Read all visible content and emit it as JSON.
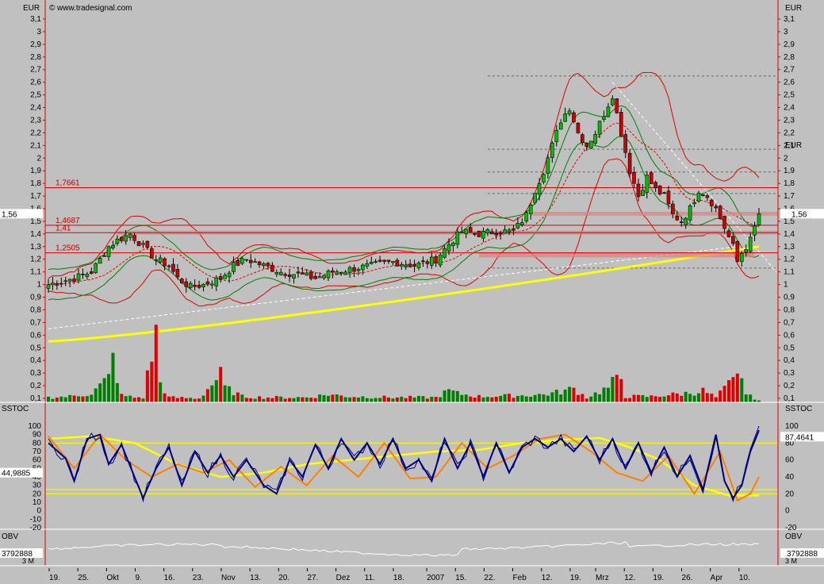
{
  "header": {
    "source": "www.tradesignal.com"
  },
  "chart_data": [
    {
      "type": "candlestick",
      "title": "",
      "unit": "EUR",
      "ylim": [
        0,
        3.15
      ],
      "y_ticks": [
        "3,1",
        "3",
        "2,9",
        "2,8",
        "2,7",
        "2,6",
        "2,5",
        "2,4",
        "2,3",
        "2,2",
        "2,1",
        "2",
        "1,9",
        "1,8",
        "1,7",
        "1,6",
        "1,5",
        "1,4",
        "1,3",
        "1,2",
        "1,1",
        "1",
        "0,9",
        "0,8",
        "0,7",
        "0,6",
        "0,5",
        "0,4",
        "0,3",
        "0,2",
        "0,1"
      ],
      "last_price_label": "1,56",
      "last_price": 1.56,
      "horizontal_levels": [
        {
          "label": "1,7661",
          "value": 1.7661
        },
        {
          "label": "1,4687",
          "value": 1.4687
        },
        {
          "label": "1,41",
          "value": 1.41
        },
        {
          "label": "1,2505",
          "value": 1.2505
        }
      ],
      "x_tick_labels": [
        "19.",
        "25.",
        "Okt",
        "9.",
        "16.",
        "23.",
        "Nov",
        "13.",
        "20.",
        "27.",
        "Dez",
        "11.",
        "18.",
        "2007",
        "15.",
        "22.",
        "Feb",
        "12.",
        "19.",
        "Mrz",
        "12.",
        "19.",
        "26.",
        "Apr",
        "10."
      ],
      "close_path": [
        [
          0,
          1.0
        ],
        [
          6,
          1.05
        ],
        [
          10,
          1.1
        ],
        [
          14,
          1.3
        ],
        [
          16,
          1.35
        ],
        [
          19,
          1.4
        ],
        [
          22,
          1.3
        ],
        [
          25,
          1.2
        ],
        [
          28,
          1.15
        ],
        [
          30,
          1.05
        ],
        [
          33,
          0.98
        ],
        [
          36,
          1.0
        ],
        [
          40,
          1.05
        ],
        [
          43,
          1.15
        ],
        [
          46,
          1.2
        ],
        [
          50,
          1.15
        ],
        [
          54,
          1.1
        ],
        [
          58,
          1.08
        ],
        [
          62,
          1.05
        ],
        [
          66,
          1.1
        ],
        [
          70,
          1.12
        ],
        [
          75,
          1.15
        ],
        [
          80,
          1.18
        ],
        [
          85,
          1.15
        ],
        [
          90,
          1.2
        ],
        [
          93,
          1.32
        ],
        [
          96,
          1.42
        ],
        [
          100,
          1.4
        ],
        [
          104,
          1.42
        ],
        [
          108,
          1.42
        ],
        [
          111,
          1.55
        ],
        [
          113,
          1.75
        ],
        [
          115,
          1.9
        ],
        [
          117,
          2.1
        ],
        [
          119,
          2.3
        ],
        [
          121,
          2.4
        ],
        [
          123,
          2.2
        ],
        [
          125,
          2.1
        ],
        [
          127,
          2.2
        ],
        [
          129,
          2.35
        ],
        [
          131,
          2.5
        ],
        [
          133,
          2.2
        ],
        [
          135,
          1.9
        ],
        [
          137,
          1.7
        ],
        [
          139,
          1.85
        ],
        [
          141,
          1.75
        ],
        [
          143,
          1.7
        ],
        [
          145,
          1.55
        ],
        [
          147,
          1.5
        ],
        [
          149,
          1.6
        ],
        [
          151,
          1.75
        ],
        [
          153,
          1.7
        ],
        [
          155,
          1.6
        ],
        [
          157,
          1.45
        ],
        [
          159,
          1.3
        ],
        [
          160,
          1.18
        ],
        [
          161,
          1.25
        ],
        [
          163,
          1.35
        ],
        [
          165,
          1.56
        ]
      ],
      "volume_path": [
        [
          0,
          0.05
        ],
        [
          5,
          0.06
        ],
        [
          10,
          0.09
        ],
        [
          14,
          0.25
        ],
        [
          15,
          0.45
        ],
        [
          17,
          0.07
        ],
        [
          20,
          0.05
        ],
        [
          22,
          0.05
        ],
        [
          25,
          0.7
        ],
        [
          26,
          0.2
        ],
        [
          28,
          0.05
        ],
        [
          35,
          0.04
        ],
        [
          40,
          0.28
        ],
        [
          41,
          0.15
        ],
        [
          45,
          0.06
        ],
        [
          50,
          0.05
        ],
        [
          60,
          0.05
        ],
        [
          65,
          0.08
        ],
        [
          70,
          0.06
        ],
        [
          80,
          0.05
        ],
        [
          90,
          0.05
        ],
        [
          93,
          0.12
        ],
        [
          95,
          0.09
        ],
        [
          100,
          0.06
        ],
        [
          110,
          0.07
        ],
        [
          115,
          0.08
        ],
        [
          118,
          0.1
        ],
        [
          122,
          0.14
        ],
        [
          125,
          0.05
        ],
        [
          130,
          0.15
        ],
        [
          131,
          0.2
        ],
        [
          133,
          0.25
        ],
        [
          134,
          0.06
        ],
        [
          140,
          0.06
        ],
        [
          145,
          0.08
        ],
        [
          150,
          0.1
        ],
        [
          152,
          0.12
        ],
        [
          155,
          0.05
        ],
        [
          158,
          0.18
        ],
        [
          160,
          0.25
        ],
        [
          161,
          0.3
        ],
        [
          162,
          0.08
        ],
        [
          165,
          0.02
        ]
      ],
      "volume_ticks": [
        "0,7",
        "0,6",
        "0,5",
        "0,4",
        "0,3",
        "0,2",
        "0,1"
      ]
    },
    {
      "type": "line",
      "title": "SSTOC",
      "ylim": [
        -20,
        100
      ],
      "y_ticks": [
        "100",
        "90",
        "80",
        "70",
        "60",
        "50",
        "40",
        "30",
        "20",
        "10",
        "0",
        "-10",
        "-20"
      ],
      "y_ticks_right": [
        "100",
        "80",
        "60",
        "40",
        "20",
        "0",
        "-20"
      ],
      "value_label_left": "44,9885",
      "value_label_right": "87,4641",
      "levels": [
        80,
        20,
        25
      ],
      "series_key_points": {
        "fast": [
          [
            0,
            80
          ],
          [
            4,
            62
          ],
          [
            6,
            35
          ],
          [
            9,
            85
          ],
          [
            12,
            90
          ],
          [
            14,
            55
          ],
          [
            17,
            78
          ],
          [
            20,
            40
          ],
          [
            22,
            15
          ],
          [
            25,
            50
          ],
          [
            28,
            75
          ],
          [
            31,
            30
          ],
          [
            34,
            70
          ],
          [
            37,
            45
          ],
          [
            40,
            65
          ],
          [
            43,
            40
          ],
          [
            46,
            60
          ],
          [
            50,
            30
          ],
          [
            53,
            20
          ],
          [
            56,
            60
          ],
          [
            59,
            40
          ],
          [
            62,
            78
          ],
          [
            65,
            50
          ],
          [
            68,
            85
          ],
          [
            71,
            60
          ],
          [
            74,
            80
          ],
          [
            77,
            55
          ],
          [
            80,
            85
          ],
          [
            83,
            50
          ],
          [
            86,
            60
          ],
          [
            89,
            35
          ],
          [
            92,
            85
          ],
          [
            95,
            50
          ],
          [
            98,
            80
          ],
          [
            101,
            40
          ],
          [
            104,
            80
          ],
          [
            107,
            45
          ],
          [
            110,
            75
          ],
          [
            113,
            85
          ],
          [
            116,
            75
          ],
          [
            119,
            85
          ],
          [
            122,
            70
          ],
          [
            125,
            88
          ],
          [
            128,
            60
          ],
          [
            131,
            85
          ],
          [
            134,
            50
          ],
          [
            137,
            80
          ],
          [
            140,
            45
          ],
          [
            143,
            75
          ],
          [
            146,
            40
          ],
          [
            149,
            65
          ],
          [
            152,
            25
          ],
          [
            155,
            90
          ],
          [
            157,
            35
          ],
          [
            159,
            15
          ],
          [
            161,
            30
          ],
          [
            163,
            70
          ],
          [
            165,
            95
          ]
        ],
        "signal_orange": [
          [
            0,
            88
          ],
          [
            6,
            50
          ],
          [
            12,
            90
          ],
          [
            18,
            60
          ],
          [
            24,
            40
          ],
          [
            30,
            55
          ],
          [
            36,
            45
          ],
          [
            42,
            60
          ],
          [
            48,
            28
          ],
          [
            54,
            52
          ],
          [
            60,
            30
          ],
          [
            66,
            65
          ],
          [
            72,
            40
          ],
          [
            78,
            80
          ],
          [
            84,
            38
          ],
          [
            90,
            40
          ],
          [
            96,
            80
          ],
          [
            102,
            50
          ],
          [
            108,
            65
          ],
          [
            114,
            85
          ],
          [
            120,
            90
          ],
          [
            126,
            70
          ],
          [
            132,
            45
          ],
          [
            138,
            35
          ],
          [
            144,
            65
          ],
          [
            150,
            20
          ],
          [
            156,
            70
          ],
          [
            160,
            12
          ],
          [
            163,
            20
          ],
          [
            165,
            40
          ]
        ],
        "slow_yellow": [
          [
            0,
            85
          ],
          [
            10,
            88
          ],
          [
            20,
            80
          ],
          [
            30,
            55
          ],
          [
            40,
            40
          ],
          [
            50,
            45
          ],
          [
            60,
            55
          ],
          [
            70,
            60
          ],
          [
            80,
            65
          ],
          [
            90,
            70
          ],
          [
            100,
            72
          ],
          [
            110,
            80
          ],
          [
            120,
            84
          ],
          [
            128,
            86
          ],
          [
            135,
            75
          ],
          [
            142,
            60
          ],
          [
            150,
            30
          ],
          [
            158,
            18
          ],
          [
            165,
            18
          ]
        ]
      }
    },
    {
      "type": "line",
      "title": "OBV",
      "y_ticks": [
        "3 M"
      ],
      "value_label_left": "3792888",
      "value_label_right": "3792888"
    }
  ]
}
